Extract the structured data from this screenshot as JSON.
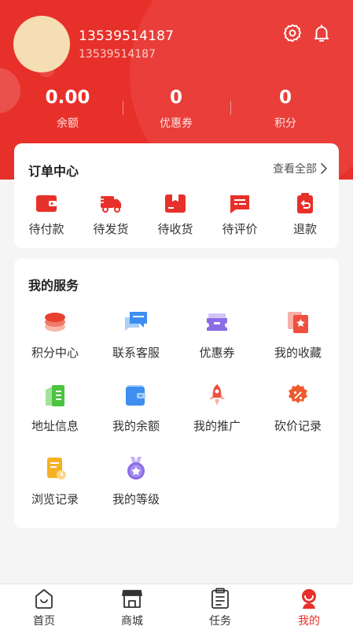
{
  "profile": {
    "username": "13539514187",
    "user_id": "13539514187"
  },
  "header_icons": [
    "gear-icon",
    "bell-icon"
  ],
  "stats": [
    {
      "value": "0.00",
      "label": "余额"
    },
    {
      "value": "0",
      "label": "优惠券"
    },
    {
      "value": "0",
      "label": "积分"
    }
  ],
  "orders": {
    "title": "订单中心",
    "view_all": "查看全部",
    "items": [
      {
        "label": "待付款",
        "icon": "wallet-icon"
      },
      {
        "label": "待发货",
        "icon": "truck-icon"
      },
      {
        "label": "待收货",
        "icon": "package-icon"
      },
      {
        "label": "待评价",
        "icon": "review-icon"
      },
      {
        "label": "退款",
        "icon": "refund-icon"
      }
    ]
  },
  "services": {
    "title": "我的服务",
    "items": [
      {
        "label": "积分中心",
        "icon": "coins-stack-icon"
      },
      {
        "label": "联系客服",
        "icon": "chat-icon"
      },
      {
        "label": "优惠券",
        "icon": "ticket-icon"
      },
      {
        "label": "我的收藏",
        "icon": "favorite-icon"
      },
      {
        "label": "地址信息",
        "icon": "address-book-icon"
      },
      {
        "label": "我的余额",
        "icon": "balance-wallet-icon"
      },
      {
        "label": "我的推广",
        "icon": "rocket-icon"
      },
      {
        "label": "砍价记录",
        "icon": "discount-badge-icon"
      },
      {
        "label": "浏览记录",
        "icon": "history-doc-icon"
      },
      {
        "label": "我的等级",
        "icon": "level-medal-icon"
      }
    ]
  },
  "tabbar": [
    {
      "label": "首页",
      "icon": "home-icon",
      "active": false
    },
    {
      "label": "商城",
      "icon": "store-icon",
      "active": false
    },
    {
      "label": "任务",
      "icon": "clipboard-icon",
      "active": false
    },
    {
      "label": "我的",
      "icon": "profile-icon",
      "active": true
    }
  ],
  "colors": {
    "brand": "#e8302a",
    "avatar_bg": "#f5deb3",
    "page_bg": "#f5f5f5"
  }
}
